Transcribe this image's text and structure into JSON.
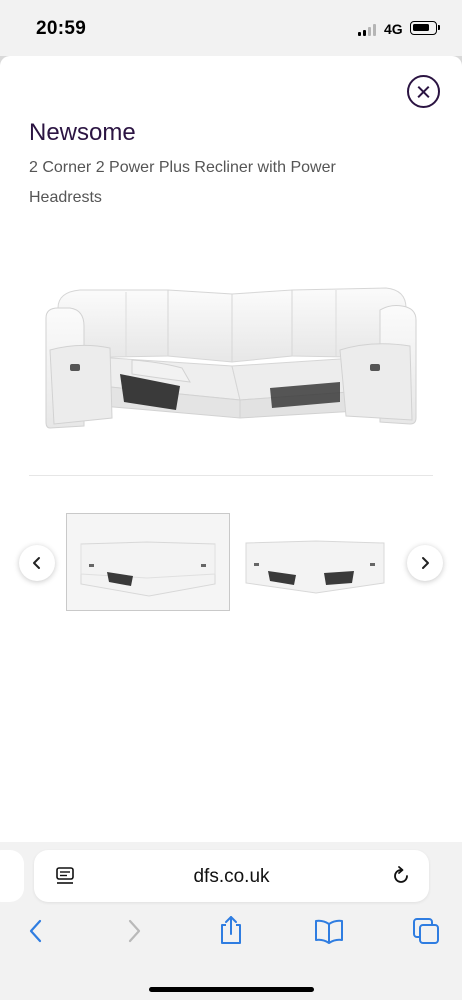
{
  "status": {
    "time": "20:59",
    "network": "4G"
  },
  "product": {
    "title": "Newsome",
    "subtitle": "2 Corner 2 Power Plus Recliner with Power Headrests"
  },
  "gallery": {
    "selected_index": 0,
    "thumbnail_count": 2
  },
  "browser": {
    "url": "dfs.co.uk"
  },
  "colors": {
    "brand": "#2b1442",
    "accent_blue": "#2f7de1",
    "disabled": "#b9b9b9"
  },
  "icons": {
    "close": "close-circle-icon",
    "prev": "chevron-left-icon",
    "next": "chevron-right-icon",
    "reader": "reader-mode-icon",
    "reload": "reload-icon",
    "back": "back-icon",
    "forward": "forward-icon",
    "share": "share-icon",
    "bookmarks": "bookmarks-icon",
    "tabs": "tabs-icon"
  }
}
